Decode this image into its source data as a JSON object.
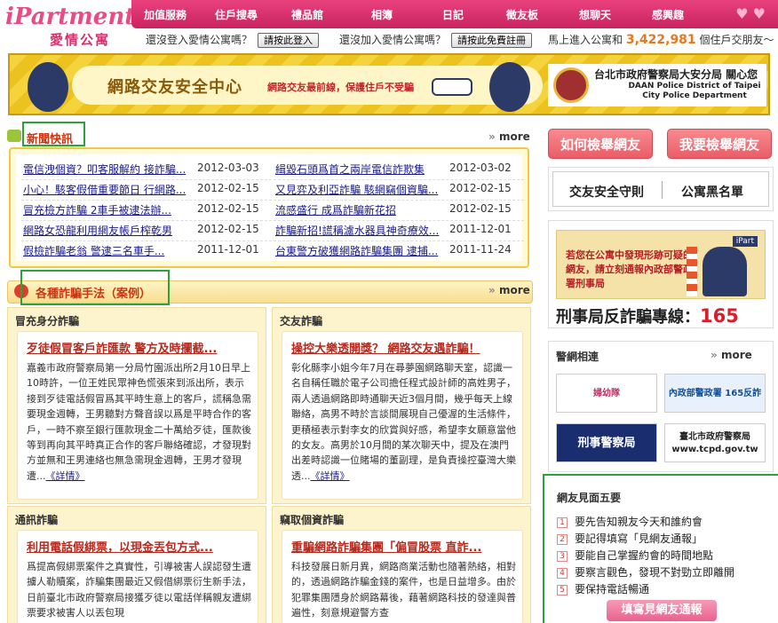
{
  "header": {
    "logo_text": "iPartment",
    "logo_sub": "愛情公寓",
    "nav": [
      "加值服務",
      "住戶搜尋",
      "禮品館",
      "相簿",
      "日記",
      "徵友板",
      "想聊天",
      "感興趣"
    ],
    "login_prompt": "還沒登入愛情公寓嗎？",
    "login_button": "請按此登入",
    "join_prompt": "還沒加入愛情公寓嗎？",
    "register_button": "請按此免費註冊",
    "member_prefix": "馬上進入公寓和",
    "member_count": "3,422,981",
    "member_suffix": "個住戶交朋友～"
  },
  "banner": {
    "title": "網路交友安全中心",
    "subtitle": "網路交友最前線，保護住戶不受騙",
    "org": "台北市政府警察局大安分局 關心您",
    "org_en": "DAAN Police District of Taipei City Police Department"
  },
  "news": {
    "title": "新聞快訊",
    "more": "more",
    "rows": [
      [
        {
          "text": "電信洩個資？叩客服解約 接詐騙...",
          "date": "2012-03-03"
        },
        {
          "text": "緝毀石頭爲首之兩岸電信詐欺集",
          "date": "2012-03-02"
        }
      ],
      [
        {
          "text": "小心！駭客假借重要節日 行網路...",
          "date": "2012-02-15"
        },
        {
          "text": "又見弈及利亞詐騙 駭網竊個資騙...",
          "date": "2012-02-15"
        }
      ],
      [
        {
          "text": "冒充檢方詐騙 2車手被逮法辦...",
          "date": "2012-02-15"
        },
        {
          "text": "流感盛行 成爲詐騙新花招",
          "date": "2012-02-15"
        }
      ],
      [
        {
          "text": "網路女恐龍利用網友帳戶榨乾男",
          "date": "2012-02-15"
        },
        {
          "text": "詐騙新招!謊稱濾水器具神奇療效...",
          "date": "2011-12-01"
        }
      ],
      [
        {
          "text": "假檢詐騙老翁 警逮三名車手...",
          "date": "2011-12-01"
        },
        {
          "text": "台東警方破獲網路詐騙集團 逮捕...",
          "date": "2011-11-24"
        }
      ]
    ]
  },
  "scams": {
    "title": "各種詐騙手法（案例）",
    "more": "more",
    "cards": [
      {
        "category": "冒充身分詐騙",
        "headline": "歹徒假冒客戶詐匯款 警方及時攔截...",
        "body": "嘉義市政府警察局第一分局竹園派出所2月10日早上10時許，一位王姓民眾神色慌張來到派出所，表示接到歹徒電話假冒爲其平時生意上的客戶，謊稱急需要現金週轉，王男聽對方聲音誤以爲是平時合作的客戶，一時不察至銀行匯款現金二十萬給歹徒，匯款後等到再向其平時真正合作的客戶聯絡確認，才發現對方並無和王男連絡也無急需現金週轉，王男才發現遭...",
        "detail": "《詳情》"
      },
      {
        "category": "交友詐騙",
        "headline": "操控大樂透開獎？ 網路交友遇詐騙！",
        "body": "彰化縣李小姐今年7月在尋夢園網路聊天室，認識一名自稱任職於電子公司擔任程式設計師的高姓男子，兩人透過網路即時通聊天近3個月間，幾乎每天上線聯絡，高男不時於言談間展現自己優渥的生活條件，更積極表示對李女的欣賞與好感，希望李女願意當他的女友。高男於10月間的某次聊天中，提及在澳門出差時認識一位賭場的董副理，是負責操控臺灣大樂透...",
        "detail": "《詳情》"
      },
      {
        "category": "通訊詐騙",
        "headline": "利用電話假綁票，以現金丟包方式...",
        "body": "爲提高假綁票案件之真實性，引導被害人誤認發生遭擄人勒贖案，詐騙集團最近又假借綁票衍生新手法，日前臺北市政府警察局接獲歹徒以電話佯稱親友遭綁票要求被害人以丟包現"
      },
      {
        "category": "竊取個資詐騙",
        "headline": "重騙網路詐騙集團「偏冒股票 直詐...",
        "body": "科技發展日新月異，網路商業活動也隨著熱絡，相對的，透過網路詐騙金錢的案件，也是日益增多。由於犯罪集團隱身於網路幕後，藉著網路科技的發達與普遍性，刻意規避警方查"
      }
    ]
  },
  "right": {
    "report_how": "如何檢舉網友",
    "report_now": "我要檢舉網友",
    "rules": "交友安全守則",
    "blacklist": "公寓黑名單",
    "hotline_ad": "若您在公寓中發現形跡可疑的網友，請立刻通報內政部警政署刑事局",
    "hotline_brand": "iPart",
    "hotline_label": "刑事局反詐騙專線：",
    "hotline_number": "165",
    "links_title": "警網相連",
    "links_more": "more",
    "link_logos": [
      "婦幼隊",
      "內政部警政署 165反詐騙專線",
      "刑事警察局",
      "臺北市政府警察局 www.tcpd.gov.tw"
    ],
    "tips_title": "網友見面五要",
    "tips": [
      "要先告知親友今天和誰約會",
      "要記得填寫「見網友通報」",
      "要能自己掌握約會的時間地點",
      "要察言觀色，發現不對勁立即離開",
      "要保持電話暢通"
    ],
    "tips_button": "填寫見網友通報"
  },
  "colors": {
    "brand_pink": "#e8417e",
    "news_red": "#c93513",
    "link_blue": "#1a1a8a",
    "highlight_green": "#2ba33a",
    "count_orange": "#e6781e"
  }
}
